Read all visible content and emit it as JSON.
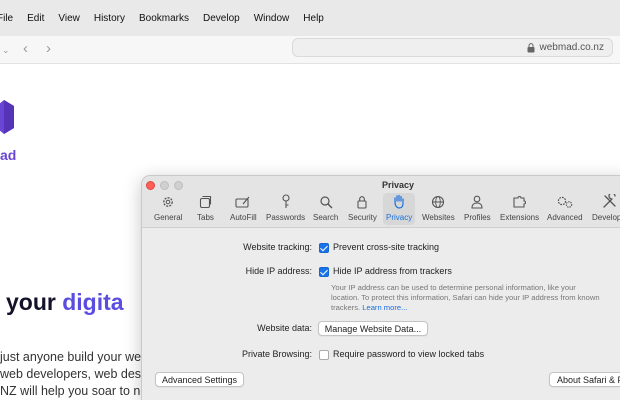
{
  "menubar": {
    "items": [
      "File",
      "Edit",
      "View",
      "History",
      "Bookmarks",
      "Develop",
      "Window",
      "Help"
    ]
  },
  "toolbar": {
    "url": "webmad.co.nz",
    "icons": [
      "chevron-down-icon",
      "back-icon",
      "forward-icon",
      "lock-icon"
    ]
  },
  "page": {
    "logo_text": "ad",
    "hero_plain": "your ",
    "hero_accent": "digita",
    "paragraph": [
      "just anyone build your web",
      "web developers, web desig",
      "NZ will help you soar to nev"
    ],
    "colors": {
      "brand": "#6b45d6",
      "accent": "#5b4de0"
    }
  },
  "prefs": {
    "title": "Privacy",
    "panes": [
      "General",
      "Tabs",
      "AutoFill",
      "Passwords",
      "Search",
      "Security",
      "Privacy",
      "Websites",
      "Profiles",
      "Extensions",
      "Advanced",
      "Developer"
    ],
    "active_pane": "Privacy",
    "website_tracking_label": "Website tracking:",
    "prevent_tracking_text": "Prevent cross-site tracking",
    "prevent_tracking_checked": true,
    "hide_ip_label": "Hide IP address:",
    "hide_ip_text": "Hide IP address from trackers",
    "hide_ip_checked": true,
    "description": "Your IP address can be used to determine personal information, like your location. To protect this information, Safari can hide your IP address from known trackers.",
    "learn_more": "Learn more...",
    "website_data_label": "Website data:",
    "manage_button": "Manage Website Data...",
    "private_browsing_label": "Private Browsing:",
    "require_password_text": "Require password to view locked tabs",
    "require_password_checked": false,
    "advanced_settings_button": "Advanced Settings",
    "about_button": "About Safari & Privacy",
    "accent_color": "#1a73e8"
  }
}
